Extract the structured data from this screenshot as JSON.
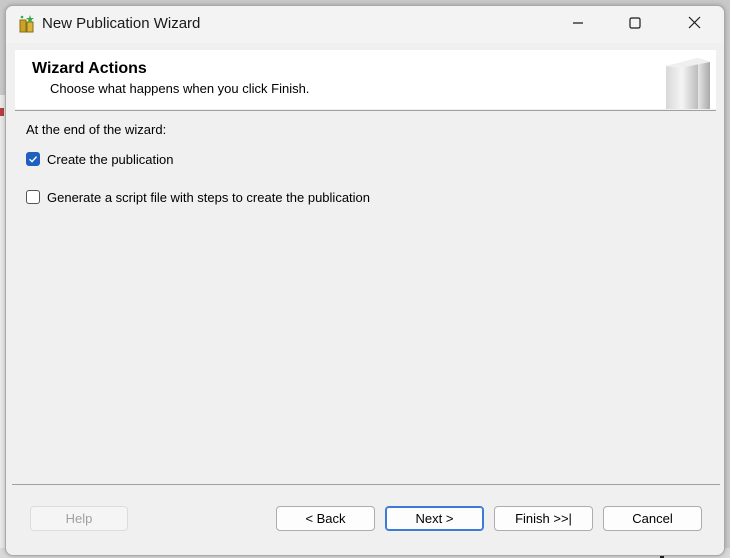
{
  "window": {
    "title": "New Publication Wizard",
    "controls": {
      "minimize_icon": "minimize-icon",
      "maximize_icon": "maximize-icon",
      "close_icon": "close-icon"
    }
  },
  "header": {
    "title": "Wizard Actions",
    "subtitle": "Choose what happens when you click Finish."
  },
  "content": {
    "intro": "At the end of the wizard:",
    "options": [
      {
        "label": "Create the publication",
        "checked": true
      },
      {
        "label": "Generate a script file with steps to create the publication",
        "checked": false
      }
    ]
  },
  "footer": {
    "help": "Help",
    "back": "< Back",
    "next": "Next >",
    "finish": "Finish >>|",
    "cancel": "Cancel"
  },
  "colors": {
    "accent": "#1f5fbf",
    "focus_border": "#3b7ad8"
  }
}
